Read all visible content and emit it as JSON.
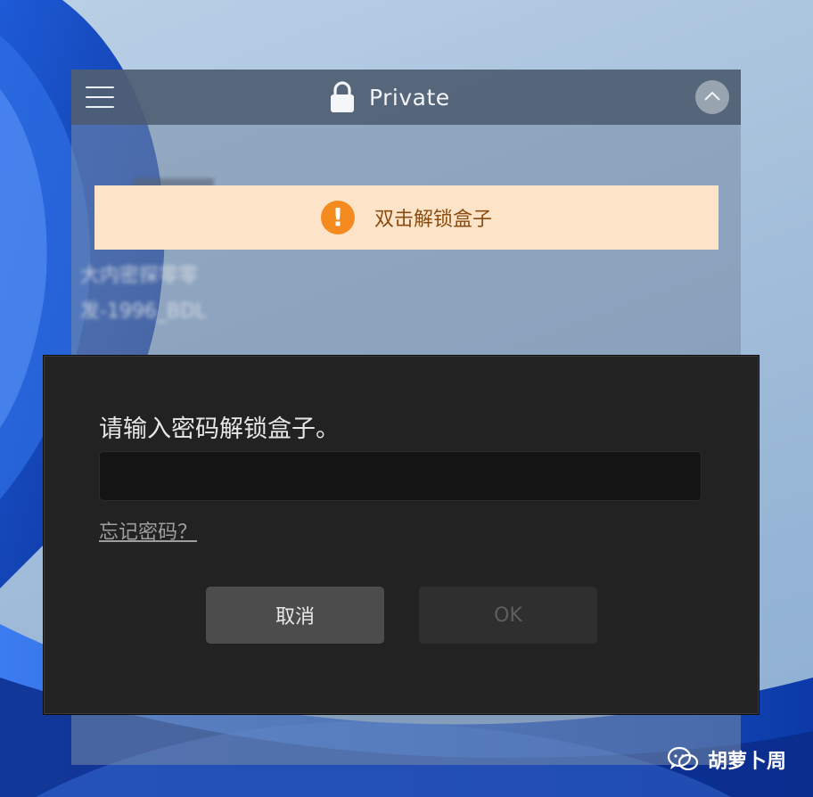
{
  "box": {
    "title": "Private",
    "notice": "双击解锁盒子",
    "blurred_file": {
      "line1": "大内密探零零",
      "line2": "发-1996_BDL"
    }
  },
  "dialog": {
    "prompt": "请输入密码解锁盒子。",
    "password_value": "",
    "forgot_password": "忘记密码？",
    "cancel_label": "取消",
    "ok_label": "OK"
  },
  "watermark": {
    "text": "胡萝卜周"
  },
  "icons": {
    "menu": "hamburger-menu-icon",
    "lock": "lock-icon",
    "collapse": "chevron-up-icon",
    "warning": "exclamation-circle-icon",
    "watermark": "wechat-icon"
  },
  "colors": {
    "notice_background": "#fde4c8",
    "warning_accent": "#f58a1f",
    "dialog_background": "#222222",
    "cancel_button": "#4c4c4c",
    "ok_button_disabled": "#2f2f2f"
  }
}
